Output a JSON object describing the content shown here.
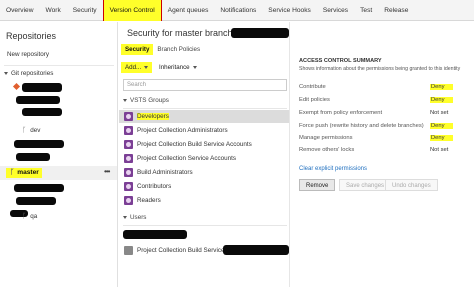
{
  "nav": {
    "tabs": [
      {
        "label": "Overview"
      },
      {
        "label": "Work"
      },
      {
        "label": "Security"
      },
      {
        "label": "Version Control"
      },
      {
        "label": "Agent queues"
      },
      {
        "label": "Notifications"
      },
      {
        "label": "Service Hooks"
      },
      {
        "label": "Services"
      },
      {
        "label": "Test"
      },
      {
        "label": "Release"
      }
    ],
    "active_tab": "Version Control"
  },
  "left": {
    "title": "Repositories",
    "new_repo": "New repository",
    "git_repos": "Git repositories",
    "branches": [
      "dev",
      "master",
      "qa"
    ]
  },
  "middle": {
    "heading": "Security for master branch in",
    "subtabs": [
      "Security",
      "Branch Policies"
    ],
    "add_label": "Add...",
    "inheritance_label": "Inheritance",
    "search_placeholder": "Search",
    "vsts_groups_label": "VSTS Groups",
    "groups": [
      "Developers",
      "Project Collection Administrators",
      "Project Collection Build Service Accounts",
      "Project Collection Service Accounts",
      "Build Administrators",
      "Contributors",
      "Readers"
    ],
    "users_label": "Users",
    "users": [
      "Project Collection Build Service"
    ]
  },
  "right": {
    "summary_title": "ACCESS CONTROL SUMMARY",
    "summary_sub": "Shows information about the permissions being granted to this identity",
    "permissions": [
      {
        "name": "Contribute",
        "value": "Deny"
      },
      {
        "name": "Edit policies",
        "value": "Deny"
      },
      {
        "name": "Exempt from policy enforcement",
        "value": "Not set"
      },
      {
        "name": "Force push (rewrite history and delete branches)",
        "value": "Deny"
      },
      {
        "name": "Manage permissions",
        "value": "Deny"
      },
      {
        "name": "Remove others' locks",
        "value": "Not set"
      }
    ],
    "clear_link": "Clear explicit permissions",
    "remove_btn": "Remove",
    "save_btn": "Save changes",
    "undo_btn": "Undo changes"
  },
  "colors": {
    "highlight": "#ffff2a",
    "group_icon": "#7b3f95",
    "link": "#1f6fbf"
  }
}
